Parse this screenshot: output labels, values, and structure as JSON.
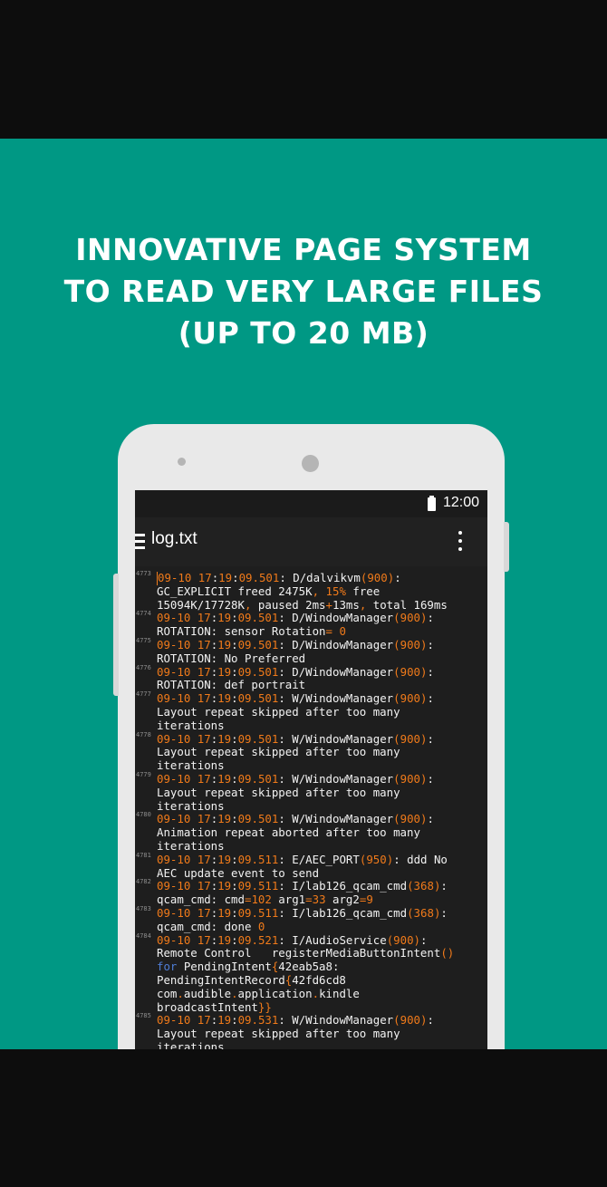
{
  "headline": {
    "line1": "INNOVATIVE PAGE SYSTEM",
    "line2": "TO READ VERY LARGE FILES",
    "line3": "(UP TO 20 MB)"
  },
  "statusbar": {
    "time": "12:00",
    "battery_icon": "battery-full-icon"
  },
  "appbar": {
    "title": "log.txt",
    "menu_icon": "hamburger-menu-icon",
    "overflow_icon": "more-vert-icon"
  },
  "colors": {
    "background": "#009884",
    "accent": "#f07a1a",
    "keyword": "#4f7ed6",
    "editor_bg": "#1e1e1e"
  },
  "log_entries": [
    {
      "num": "4773",
      "lines": [
        "09-10 17:19:09.501: D/dalvikvm(900):",
        "GC_EXPLICIT freed 2475K, 15% free",
        "15094K/17728K, paused 2ms+13ms, total 169ms"
      ]
    },
    {
      "num": "4774",
      "lines": [
        "09-10 17:19:09.501: D/WindowManager(900):",
        "ROTATION: sensor Rotation= 0"
      ]
    },
    {
      "num": "4775",
      "lines": [
        "09-10 17:19:09.501: D/WindowManager(900):",
        "ROTATION: No Preferred"
      ]
    },
    {
      "num": "4776",
      "lines": [
        "09-10 17:19:09.501: D/WindowManager(900):",
        "ROTATION: def portrait"
      ]
    },
    {
      "num": "4777",
      "lines": [
        "09-10 17:19:09.501: W/WindowManager(900):",
        "Layout repeat skipped after too many",
        "iterations"
      ]
    },
    {
      "num": "4778",
      "lines": [
        "09-10 17:19:09.501: W/WindowManager(900):",
        "Layout repeat skipped after too many",
        "iterations"
      ]
    },
    {
      "num": "4779",
      "lines": [
        "09-10 17:19:09.501: W/WindowManager(900):",
        "Layout repeat skipped after too many",
        "iterations"
      ]
    },
    {
      "num": "4780",
      "lines": [
        "09-10 17:19:09.501: W/WindowManager(900):",
        "Animation repeat aborted after too many",
        "iterations"
      ]
    },
    {
      "num": "4781",
      "lines": [
        "09-10 17:19:09.511: E/AEC_PORT(950): ddd No",
        "AEC update event to send"
      ]
    },
    {
      "num": "4782",
      "lines": [
        "09-10 17:19:09.511: I/lab126_qcam_cmd(368):",
        "qcam_cmd: cmd=102 arg1=33 arg2=9"
      ]
    },
    {
      "num": "4783",
      "lines": [
        "09-10 17:19:09.511: I/lab126_qcam_cmd(368):",
        "qcam_cmd: done 0"
      ]
    },
    {
      "num": "4784",
      "lines": [
        "09-10 17:19:09.521: I/AudioService(900):",
        "Remote Control   registerMediaButtonIntent()",
        "for PendingIntent{42eab5a8:",
        "PendingIntentRecord{42fd6cd8",
        "com.audible.application.kindle",
        "broadcastIntent}}"
      ]
    },
    {
      "num": "4785",
      "lines": [
        "09-10 17:19:09.531: W/WindowManager(900):",
        "Layout repeat skipped after too many",
        "iterations"
      ]
    }
  ]
}
